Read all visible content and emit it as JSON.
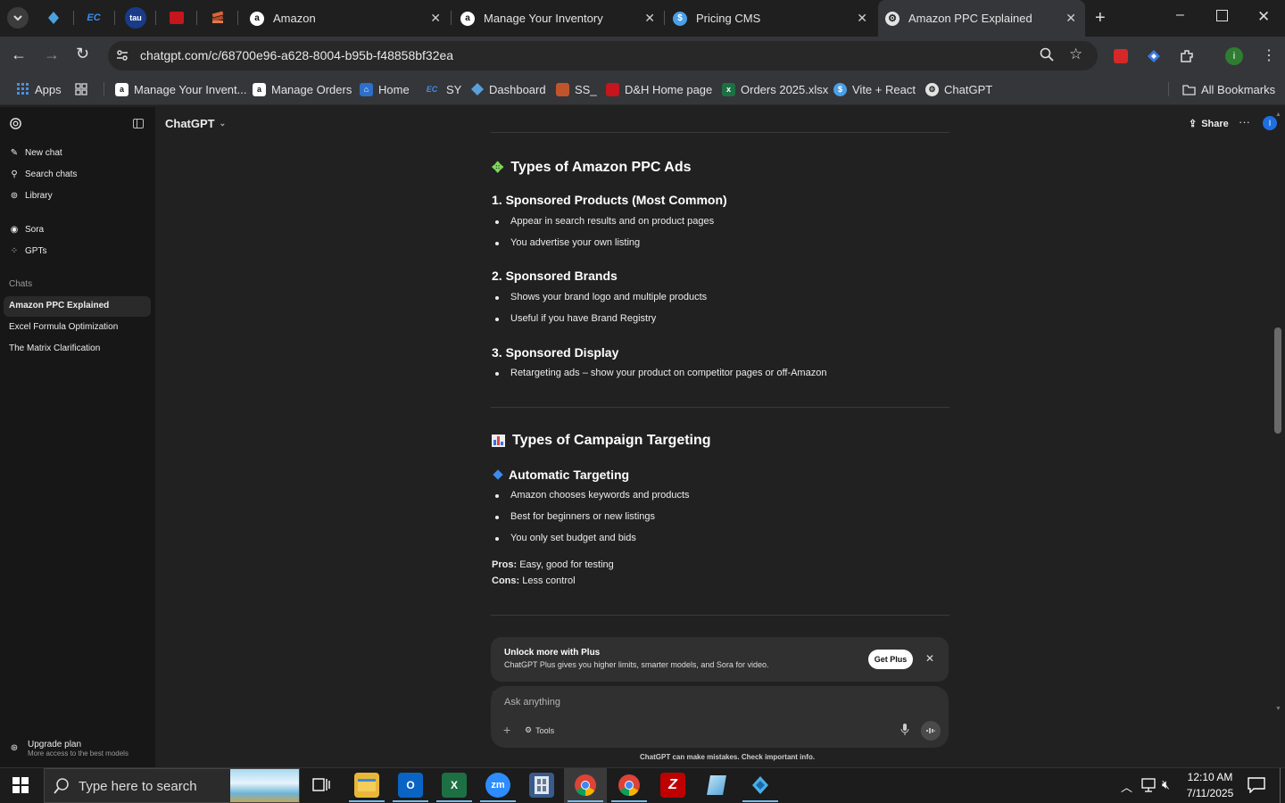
{
  "browser": {
    "pinned_tabs": [
      {
        "icon": "app-diamond-icon",
        "color": "#3b7bbf"
      },
      {
        "icon": "ec-icon",
        "label": "EC",
        "color": "#2a6fd6"
      },
      {
        "icon": "tau-icon",
        "label": "tau",
        "color": "#1a3b8a"
      },
      {
        "icon": "dh-icon",
        "label": "D&H",
        "color": "#c4161c"
      },
      {
        "icon": "stack-icon",
        "color": "#c0552b"
      }
    ],
    "tabs": [
      {
        "title": "Amazon",
        "icon": "amazon-icon"
      },
      {
        "title": "Manage Your Inventory",
        "icon": "amazon-icon"
      },
      {
        "title": "Pricing CMS",
        "icon": "dollar-icon"
      },
      {
        "title": "Amazon PPC Explained",
        "icon": "chatgpt-icon",
        "active": true
      }
    ],
    "url": "chatgpt.com/c/68700e96-a628-8004-b95b-f48858bf32ea",
    "bookmarks": [
      {
        "label": "Apps",
        "icon": "apps-grid-icon"
      },
      {
        "label": "",
        "icon": "tab-groups-icon"
      },
      {
        "label": "Manage Your Invent...",
        "icon": "amazon-icon"
      },
      {
        "label": "Manage Orders",
        "icon": "amazon-icon"
      },
      {
        "label": "Home",
        "icon": "home-icon"
      },
      {
        "label": "SY",
        "icon": "ec-icon"
      },
      {
        "label": "Dashboard",
        "icon": "dashboard-icon"
      },
      {
        "label": "SS_",
        "icon": "stack-icon"
      },
      {
        "label": "D&H Home page",
        "icon": "dh-icon"
      },
      {
        "label": "Orders 2025.xlsx",
        "icon": "excel-icon"
      },
      {
        "label": "Vite + React",
        "icon": "dollar-icon"
      },
      {
        "label": "ChatGPT",
        "icon": "chatgpt-icon"
      }
    ],
    "all_bookmarks": "All Bookmarks"
  },
  "sidebar": {
    "new_chat": "New chat",
    "search_chats": "Search chats",
    "library": "Library",
    "sora": "Sora",
    "gpts": "GPTs",
    "chats_heading": "Chats",
    "chats": [
      "Amazon PPC Explained",
      "Excel Formula Optimization",
      "The Matrix Clarification"
    ],
    "upgrade_title": "Upgrade plan",
    "upgrade_sub": "More access to the best models"
  },
  "header": {
    "model": "ChatGPT",
    "share": "Share"
  },
  "content": {
    "section1_title": "Types of Amazon PPC Ads",
    "sp_title": "1. Sponsored Products (Most Common)",
    "sp_bullets": [
      "Appear in search results and on product pages",
      "You advertise your own listing"
    ],
    "sb_title": "2. Sponsored Brands",
    "sb_bullets": [
      "Shows your brand logo and multiple products",
      "Useful if you have Brand Registry"
    ],
    "sd_title": "3. Sponsored Display",
    "sd_bullets": [
      "Retargeting ads – show your product on competitor pages or off-Amazon"
    ],
    "section2_title": "Types of Campaign Targeting",
    "auto_title": "Automatic Targeting",
    "auto_bullets": [
      "Amazon chooses keywords and products",
      "Best for beginners or new listings",
      "You only set budget and bids"
    ],
    "pros_label": "Pros:",
    "pros_text": "Easy, good for testing",
    "cons_label": "Cons:",
    "cons_text": "Less control"
  },
  "plus_banner": {
    "title": "Unlock more with Plus",
    "text": "ChatGPT Plus gives you higher limits, smarter models, and Sora for video.",
    "button": "Get Plus"
  },
  "composer": {
    "placeholder": "Ask anything",
    "tools": "Tools",
    "disclaimer": "ChatGPT can make mistakes. Check important info."
  },
  "taskbar": {
    "search_placeholder": "Type here to search",
    "time": "12:10 AM",
    "date": "7/11/2025",
    "apps": [
      "file-explorer-icon",
      "outlook-icon",
      "excel-icon",
      "zoom-icon",
      "calculator-icon",
      "chrome-icon",
      "chrome-icon",
      "filezilla-icon",
      "notepad-icon",
      "app-diamond-icon"
    ]
  }
}
